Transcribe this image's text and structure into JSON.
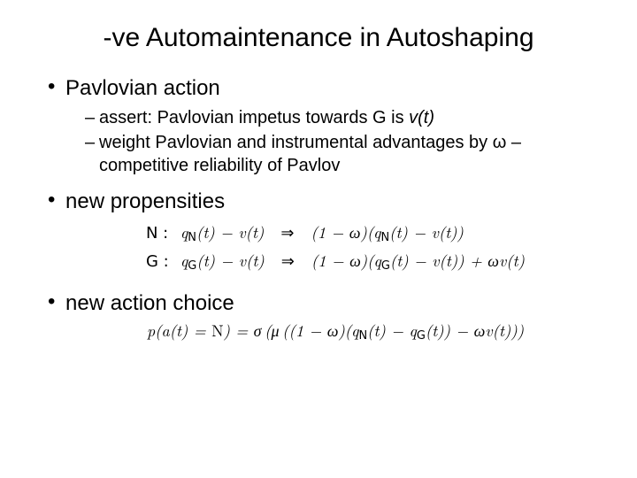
{
  "title": "-ve Automaintenance in Autoshaping",
  "bullets": {
    "b1": "Pavlovian action",
    "b1s1_pre": "assert: Pavlovian impetus towards G is ",
    "b1s1_it": "v(t)",
    "b1s2_a": "weight Pavlovian and instrumental advantages by ",
    "b1s2_w": "ω",
    "b1s2_b": " – competitive reliability of Pavlov",
    "b2": "new propensities",
    "b3": "new action choice"
  },
  "equations": {
    "n_label": "N :",
    "n_lhs": "q_N(t) − v(t)",
    "n_rhs": "(1 − ω)(q_N(t) − v(t))",
    "g_label": "G :",
    "g_lhs": "q_G(t) − v(t)",
    "g_rhs": "(1 − ω)(q_G(t) − v(t)) + ωv(t)",
    "action": "p(a(t) = N) = σ (μ ((1 − ω)(q_N(t) − q_G(t)) − ωv(t)))"
  }
}
